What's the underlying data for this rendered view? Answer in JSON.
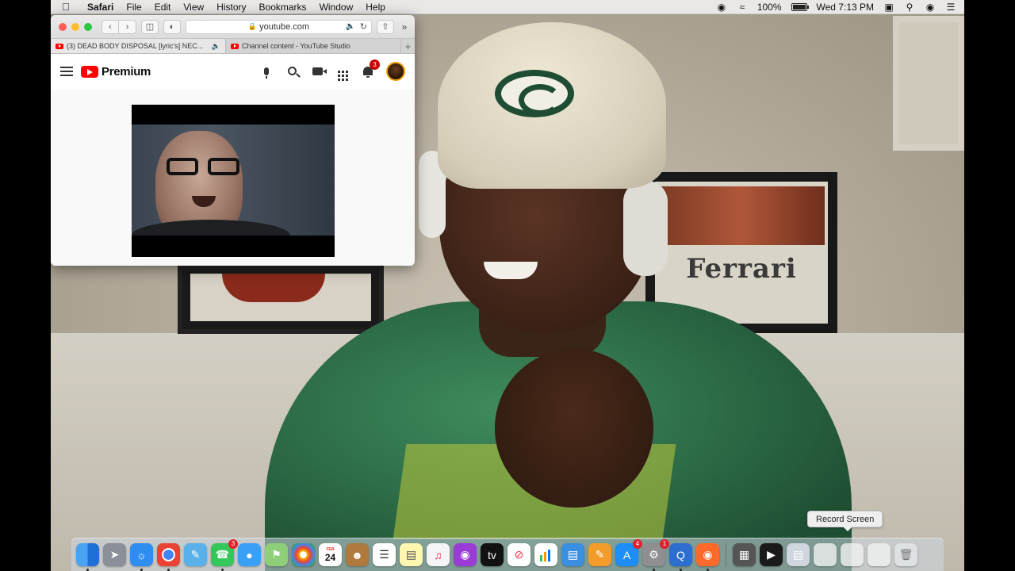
{
  "menubar": {
    "app_name": "Safari",
    "menus": [
      "File",
      "Edit",
      "View",
      "History",
      "Bookmarks",
      "Window",
      "Help"
    ],
    "battery_percent": "100%",
    "clock": "Wed 7:13 PM",
    "status_icons": [
      "record-stop-icon",
      "wifi-icon",
      "battery-icon",
      "display-icon",
      "search-icon",
      "siri-icon",
      "notification-center-icon"
    ]
  },
  "safari": {
    "address": "youtube.com",
    "tabs": [
      {
        "label": "(3) DEAD BODY DISPOSAL [lyric's] NEC...",
        "active": true
      },
      {
        "label": "Channel content - YouTube Studio",
        "active": false
      }
    ]
  },
  "youtube": {
    "logo_text": "Premium",
    "notification_count": "3"
  },
  "scene": {
    "poster_text": "Ferrari"
  },
  "tooltip": {
    "text": "Record Screen"
  },
  "dock": {
    "calendar_month": "FEB",
    "calendar_day": "24",
    "facetime_badge": "3",
    "appstore_badge": "4",
    "settings_badge": "1"
  },
  "colors": {
    "yt_red": "#ff0000",
    "badge_red": "#cc0000",
    "menubar_bg": "#e9e8e7"
  }
}
